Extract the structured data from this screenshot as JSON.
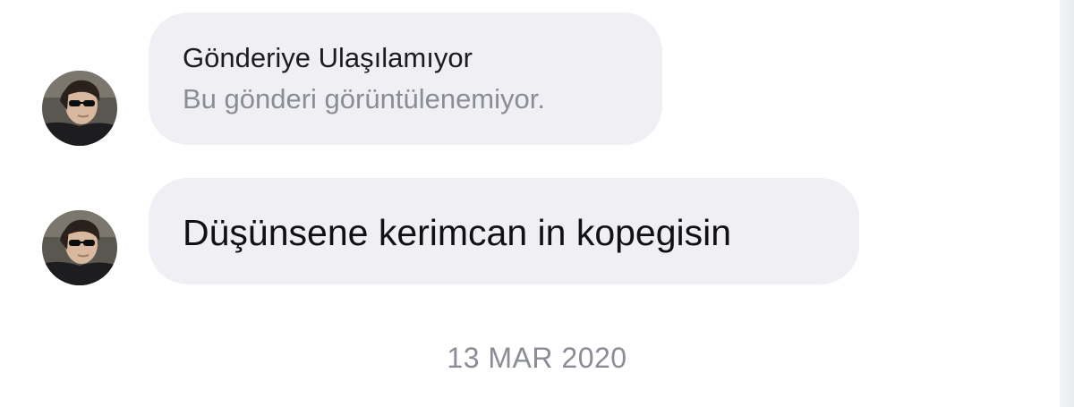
{
  "messages": [
    {
      "type": "shared_post_unavailable",
      "title": "Gönderiye Ulaşılamıyor",
      "subtitle": "Bu gönderi görüntülenemiyor.",
      "avatar_icon": "profile-photo"
    },
    {
      "type": "text",
      "text": "Düşünsene kerimcan in kopegisin",
      "avatar_icon": "profile-photo"
    }
  ],
  "date_separator": "13 MAR 2020",
  "colors": {
    "bubble_background": "#efeff4",
    "primary_text": "#1c1c1e",
    "secondary_text": "#8a8d95"
  }
}
